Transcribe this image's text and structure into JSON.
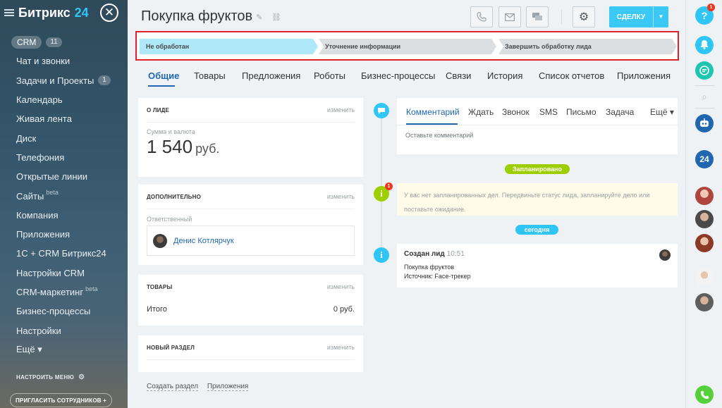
{
  "sidebar": {
    "brand_name": "Битрикс",
    "brand_num": "24",
    "close_glyph": "✕",
    "items": [
      {
        "label": "CRM",
        "count": "11"
      },
      {
        "label": "Чат и звонки"
      },
      {
        "label": "Задачи и Проекты",
        "count": "1"
      },
      {
        "label": "Календарь"
      },
      {
        "label": "Живая лента"
      },
      {
        "label": "Диск"
      },
      {
        "label": "Телефония"
      },
      {
        "label": "Открытые линии"
      },
      {
        "label": "Сайты",
        "beta": "beta"
      },
      {
        "label": "Компания"
      },
      {
        "label": "Приложения"
      },
      {
        "label": "1С + CRM Битрикс24"
      },
      {
        "label": "Настройки CRM"
      },
      {
        "label": "CRM-маркетинг",
        "beta": "beta"
      },
      {
        "label": "Бизнес-процессы"
      },
      {
        "label": "Настройки"
      },
      {
        "label": "Ещё ▾"
      }
    ],
    "configure_label": "НАСТРОИТЬ МЕНЮ",
    "invite_label": "ПРИГЛАСИТЬ СОТРУДНИКОВ  +"
  },
  "header": {
    "title": "Покупка фруктов",
    "deal_button": "СДЕЛКУ",
    "icons": [
      "pencil-icon",
      "link-icon",
      "phone-icon",
      "mail-icon",
      "chat-icon",
      "gear-icon"
    ]
  },
  "stages": [
    "Не обработан",
    "Уточнение информации",
    "Завершить обработку лида"
  ],
  "tabs": [
    "Общие",
    "Товары",
    "Предложения",
    "Роботы",
    "Бизнес-процессы",
    "Связи",
    "История",
    "Список отчетов",
    "Приложения"
  ],
  "cards": {
    "about": {
      "title": "О ЛИДЕ",
      "edit": "изменить",
      "amount_label": "Сумма и валюта",
      "amount": "1 540",
      "currency": "руб."
    },
    "extra": {
      "title": "ДОПОЛНИТЕЛЬНО",
      "edit": "изменить",
      "responsible_label": "Ответственный",
      "responsible_name": "Денис Котлярчук"
    },
    "products": {
      "title": "ТОВАРЫ",
      "edit": "изменить",
      "total_label": "Итого",
      "total_value": "0 руб."
    },
    "new_section": {
      "title": "НОВЫЙ РАЗДЕЛ",
      "edit": "изменить"
    }
  },
  "bottom_links": [
    "Создать раздел",
    "Приложения"
  ],
  "composer": {
    "tabs": [
      "Комментарий",
      "Ждать",
      "Звонок",
      "SMS",
      "Письмо",
      "Задача",
      "Ещё ▾"
    ],
    "placeholder": "Оставьте комментарий"
  },
  "timeline": {
    "planned_pill": "Запланировано",
    "planned_badge": "1",
    "planned_text": "У вас нет запланированных дел. Передвиньте статус лида, запланируйте дело или поставьте ожидание.",
    "today_pill": "сегодня",
    "event_title": "Создан лид",
    "event_time": "10:51",
    "event_line1": "Покупка фруктов",
    "event_line2": "Источник: Face-трекер"
  },
  "rightbar": {
    "help_badge": "1",
    "bitrix_label": "24"
  },
  "colors": {
    "accent": "#2fc6f6",
    "link": "#2067b0",
    "stage_active": "#afe8f9",
    "stage_inactive": "#dcdfe2",
    "green": "#9dcf00",
    "highlight_frame": "#e0232b"
  }
}
